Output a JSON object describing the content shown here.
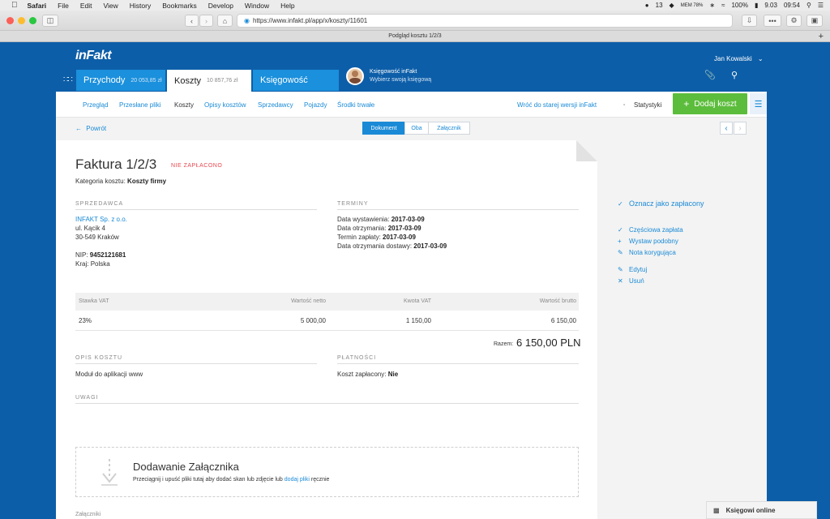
{
  "menubar": {
    "app": "Safari",
    "items": [
      "File",
      "Edit",
      "View",
      "History",
      "Bookmarks",
      "Develop",
      "Window",
      "Help"
    ],
    "status_count": "13",
    "mem": "MEM 78%",
    "battery": "100%",
    "date": "9.03",
    "time": "09:54"
  },
  "browser": {
    "url": "https://www.infakt.pl/app/x/koszty/11601",
    "tab_title": "Podgląd kosztu 1/2/3"
  },
  "header": {
    "logo": "inFakt",
    "user_name": "Jan Kowalski",
    "tabs": [
      {
        "label": "Przychody",
        "amount": "20 053,85 zł"
      },
      {
        "label": "Koszty",
        "amount": "10 857,76 zł"
      },
      {
        "label": "Księgowość",
        "amount": ""
      }
    ],
    "accountant_line1": "Księgowość inFakt",
    "accountant_line2": "Wybierz swoją księgową"
  },
  "subnav": {
    "items": [
      "Przegląd",
      "Przesłane pliki",
      "Koszty",
      "Opisy kosztów",
      "Sprzedawcy",
      "Pojazdy",
      "Środki trwałe"
    ],
    "old_version": "Wróć do starej wersji inFakt",
    "stats": "Statystyki",
    "add_button": "Dodaj koszt"
  },
  "viewbar": {
    "back": "Powrót",
    "segments": [
      "Dokument",
      "Oba",
      "Załącznik"
    ]
  },
  "invoice": {
    "title": "Faktura 1/2/3",
    "status": "NIE ZAPŁACONO",
    "category_label": "Kategoria kosztu:",
    "category_value": "Koszty firmy",
    "seller_heading": "SPRZEDAWCA",
    "seller_name": "INFAKT Sp. z o.o.",
    "seller_street": "ul. Kącik 4",
    "seller_city": "30-549 Kraków",
    "nip_label": "NIP:",
    "nip_value": "9452121681",
    "country_label": "Kraj:",
    "country_value": "Polska",
    "terms_heading": "TERMINY",
    "issue_label": "Data wystawienia:",
    "issue_value": "2017-03-09",
    "received_label": "Data otrzymania:",
    "received_value": "2017-03-09",
    "due_label": "Termin zapłaty:",
    "due_value": "2017-03-09",
    "delivery_label": "Data otrzymania dostawy:",
    "delivery_value": "2017-03-09",
    "vat_headers": [
      "Stawka VAT",
      "Wartość netto",
      "Kwota VAT",
      "Wartość brutto"
    ],
    "vat_row": [
      "23%",
      "5 000,00",
      "1 150,00",
      "6 150,00"
    ],
    "total_label": "Razem:",
    "total_value": "6 150,00 PLN",
    "desc_heading": "OPIS KOSZTU",
    "desc_value": "Moduł do aplikacji www",
    "payments_heading": "PŁATNOŚCI",
    "paid_label": "Koszt zapłacony:",
    "paid_value": "Nie",
    "notes_heading": "UWAGI",
    "attach_title": "Dodawanie Załącznika",
    "attach_text_pre": "Przeciągnij i upuść pliki tutaj aby dodać skan lub zdjęcie lub",
    "attach_link": "dodaj pliki",
    "attach_text_post": "ręcznie",
    "attachments_label": "Załączniki"
  },
  "actions": {
    "mark_paid": "Oznacz jako zapłacony",
    "partial": "Częściowa zapłata",
    "similar": "Wystaw podobny",
    "correction": "Nota korygująca",
    "edit": "Edytuj",
    "delete": "Usuń"
  },
  "chat": {
    "label": "Księgowi online"
  },
  "colors": {
    "brand": "#0d5ea8",
    "accent": "#1a8ad6",
    "add_green": "#5cbd3c",
    "unpaid_red": "#e8474e"
  }
}
